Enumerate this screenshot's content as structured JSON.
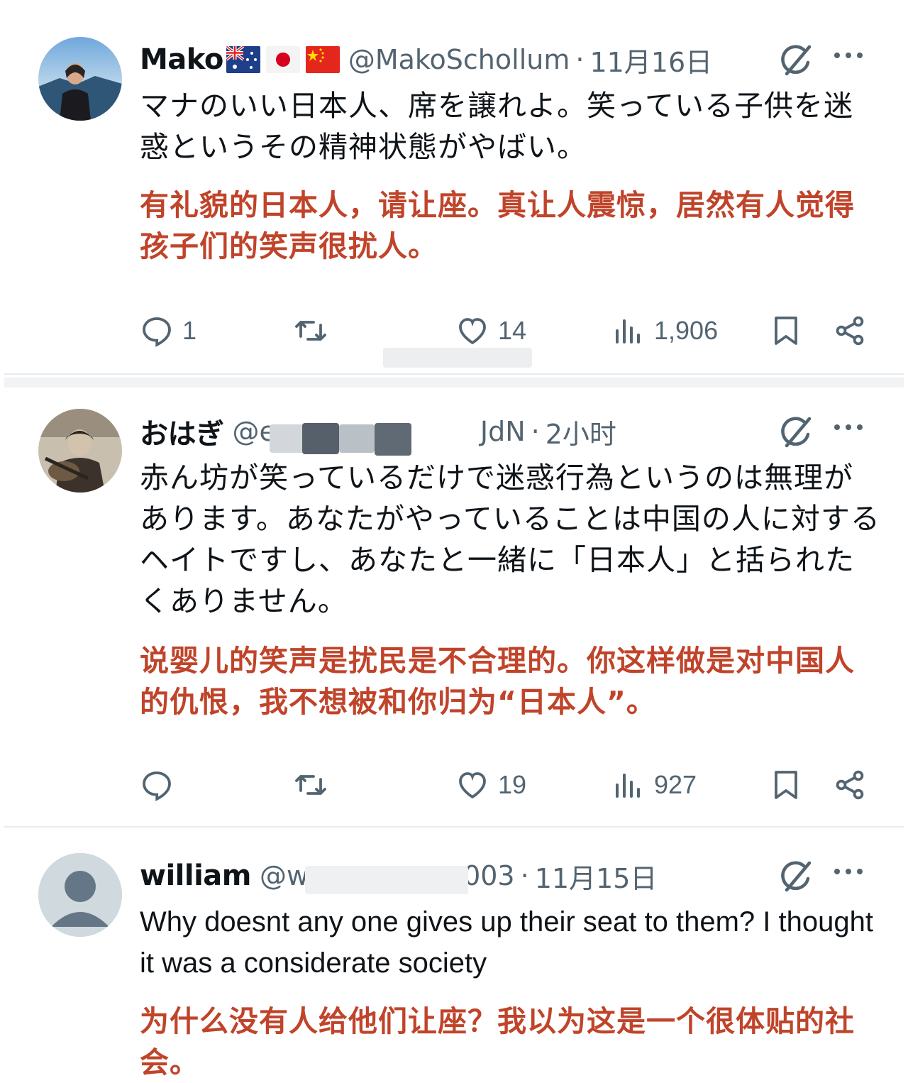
{
  "tweets": [
    {
      "display_name": "Mako",
      "flags": [
        "australia-flag",
        "japan-flag",
        "china-flag"
      ],
      "handle": "@MakoSchollum",
      "separator": "·",
      "time": "11月16日",
      "text_ja": "マナのいい日本人、席を譲れよ。笑っている子供を迷惑というその精神状態がやばい。",
      "text_zh": "有礼貌的日本人，请让座。真让人震惊，居然有人觉得孩子们的笑声很扰人。",
      "replies": "1",
      "retweets": "",
      "likes": "14",
      "views": "1,906"
    },
    {
      "display_name": "おはぎ",
      "handle": "@e",
      "handle_suffix": "JdN",
      "separator": "·",
      "time": "2小时",
      "text_ja": "赤ん坊が笑っているだけで迷惑行為というのは無理があります。あなたがやっていることは中国の人に対するヘイトですし、あなたと一緒に「日本人」と括られたくありません。",
      "text_zh": "说婴儿的笑声是扰民是不合理的。你这样做是对中国人的仇恨，我不想被和你归为“日本人”。",
      "replies": "",
      "retweets": "",
      "likes": "19",
      "views": "927"
    },
    {
      "display_name": "william",
      "handle": "@w",
      "handle_suffix": "003",
      "separator": "·",
      "time": "11月15日",
      "text_en": "Why doesnt any one gives up their seat to them? I thought it was a considerate society",
      "text_zh": "为什么没有人给他们让座？我以为这是一个很体贴的社会。"
    }
  ],
  "colors": {
    "translation_text": "#c0442a",
    "secondary_text": "#536471",
    "primary_text": "#0f1419"
  },
  "icons": [
    "grok-icon",
    "more-icon",
    "reply-icon",
    "retweet-icon",
    "like-icon",
    "views-icon",
    "bookmark-icon",
    "share-icon"
  ]
}
